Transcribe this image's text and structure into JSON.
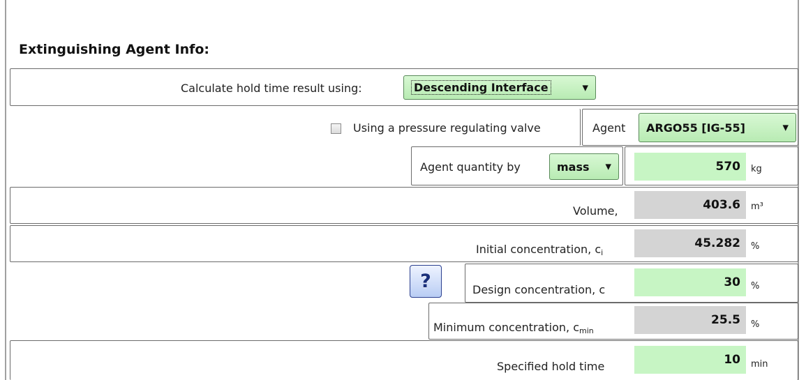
{
  "section_title": "Extinguishing Agent Info:",
  "hold_time_method": {
    "label": "Calculate hold time result using:",
    "selected": "Descending Interface"
  },
  "pressure_valve": {
    "label": "Using a pressure regulating valve",
    "checked": false
  },
  "agent": {
    "label": "Agent",
    "selected": "ARGO55 [IG-55]"
  },
  "quantity": {
    "label": "Agent quantity by",
    "mode": "mass",
    "value": "570",
    "unit": "kg"
  },
  "volume": {
    "label": "Volume,",
    "value": "403.6",
    "unit": "m³"
  },
  "initial_concentration": {
    "label": "Initial concentration, c",
    "subscript": "i",
    "value": "45.282",
    "unit": "%"
  },
  "help": {
    "glyph": "?",
    "icon": "question-icon"
  },
  "design_concentration": {
    "label": "Design concentration, c",
    "value": "30",
    "unit": "%"
  },
  "minimum_concentration": {
    "label": "Minimum concentration, c",
    "subscript": "min",
    "value": "25.5",
    "unit": "%"
  },
  "hold_time": {
    "label": "Specified hold time",
    "value": "10",
    "unit": "min"
  },
  "colors": {
    "input_green": "#c7f5c4",
    "readonly_grey": "#d4d4d4",
    "border": "#6b6b6b"
  }
}
